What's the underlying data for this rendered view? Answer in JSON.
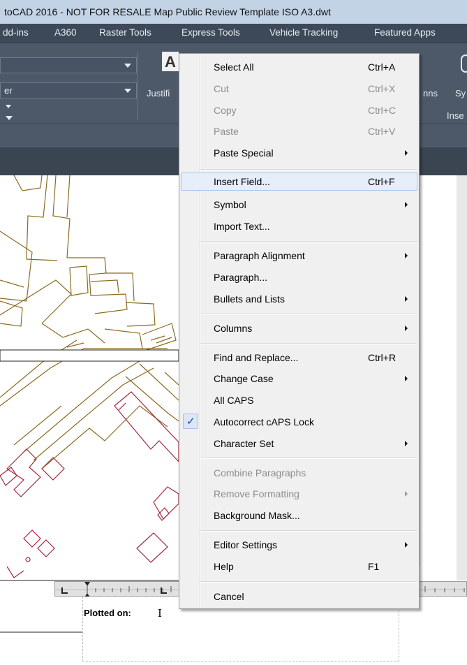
{
  "window": {
    "title": "toCAD 2016 - NOT FOR RESALE   Map Public Review Template ISO A3.dwt"
  },
  "ribbon_tabs": [
    "dd-ins",
    "A360",
    "Raster Tools",
    "Express Tools",
    "Vehicle Tracking",
    "Featured Apps"
  ],
  "ribbon": {
    "style_combo_text": "",
    "layer_combo_text": "er",
    "justify_label": "Justifi",
    "columns_label": "nns",
    "symbol_label": "Sy",
    "insert_panel_label": "Inse"
  },
  "context_menu": {
    "items": [
      {
        "label": "Select All",
        "shortcut": "Ctrl+A",
        "disabled": false,
        "submenu": false
      },
      {
        "label": "Cut",
        "shortcut": "Ctrl+X",
        "disabled": true,
        "submenu": false
      },
      {
        "label": "Copy",
        "shortcut": "Ctrl+C",
        "disabled": true,
        "submenu": false
      },
      {
        "label": "Paste",
        "shortcut": "Ctrl+V",
        "disabled": true,
        "submenu": false
      },
      {
        "label": "Paste Special",
        "shortcut": "",
        "disabled": false,
        "submenu": true
      },
      {
        "label": "Insert Field...",
        "shortcut": "Ctrl+F",
        "disabled": false,
        "submenu": false,
        "highlighted": true
      },
      {
        "label": "Symbol",
        "shortcut": "",
        "disabled": false,
        "submenu": true
      },
      {
        "label": "Import Text...",
        "shortcut": "",
        "disabled": false,
        "submenu": false
      },
      {
        "label": "Paragraph Alignment",
        "shortcut": "",
        "disabled": false,
        "submenu": true
      },
      {
        "label": "Paragraph...",
        "shortcut": "",
        "disabled": false,
        "submenu": false
      },
      {
        "label": "Bullets and Lists",
        "shortcut": "",
        "disabled": false,
        "submenu": true
      },
      {
        "label": "Columns",
        "shortcut": "",
        "disabled": false,
        "submenu": true
      },
      {
        "label": "Find and Replace...",
        "shortcut": "Ctrl+R",
        "disabled": false,
        "submenu": false
      },
      {
        "label": "Change Case",
        "shortcut": "",
        "disabled": false,
        "submenu": true
      },
      {
        "label": "All CAPS",
        "shortcut": "",
        "disabled": false,
        "submenu": false
      },
      {
        "label": "Autocorrect cAPS Lock",
        "shortcut": "",
        "disabled": false,
        "submenu": false,
        "checked": true
      },
      {
        "label": "Character Set",
        "shortcut": "",
        "disabled": false,
        "submenu": true
      },
      {
        "label": "Combine Paragraphs",
        "shortcut": "",
        "disabled": true,
        "submenu": false
      },
      {
        "label": "Remove Formatting",
        "shortcut": "",
        "disabled": true,
        "submenu": true
      },
      {
        "label": "Background Mask...",
        "shortcut": "",
        "disabled": false,
        "submenu": false
      },
      {
        "label": "Editor Settings",
        "shortcut": "",
        "disabled": false,
        "submenu": true
      },
      {
        "label": "Help",
        "shortcut": "F1",
        "disabled": false,
        "submenu": false
      },
      {
        "label": "Cancel",
        "shortcut": "",
        "disabled": false,
        "submenu": false
      }
    ]
  },
  "text_editor": {
    "content": "Plotted on:",
    "cursor": "I"
  },
  "colors": {
    "ribbon_bg": "#4d5969",
    "menu_bg": "#f0f0f0",
    "highlight": "#e5eef9",
    "parcel_lines": "#8a6b22",
    "building_lines": "#a12a3e",
    "check_mark": "#1a3fa8"
  },
  "icons": {
    "check": "check-icon",
    "submenu": "submenu-arrow-icon",
    "dropdown": "dropdown-arrow-icon"
  }
}
